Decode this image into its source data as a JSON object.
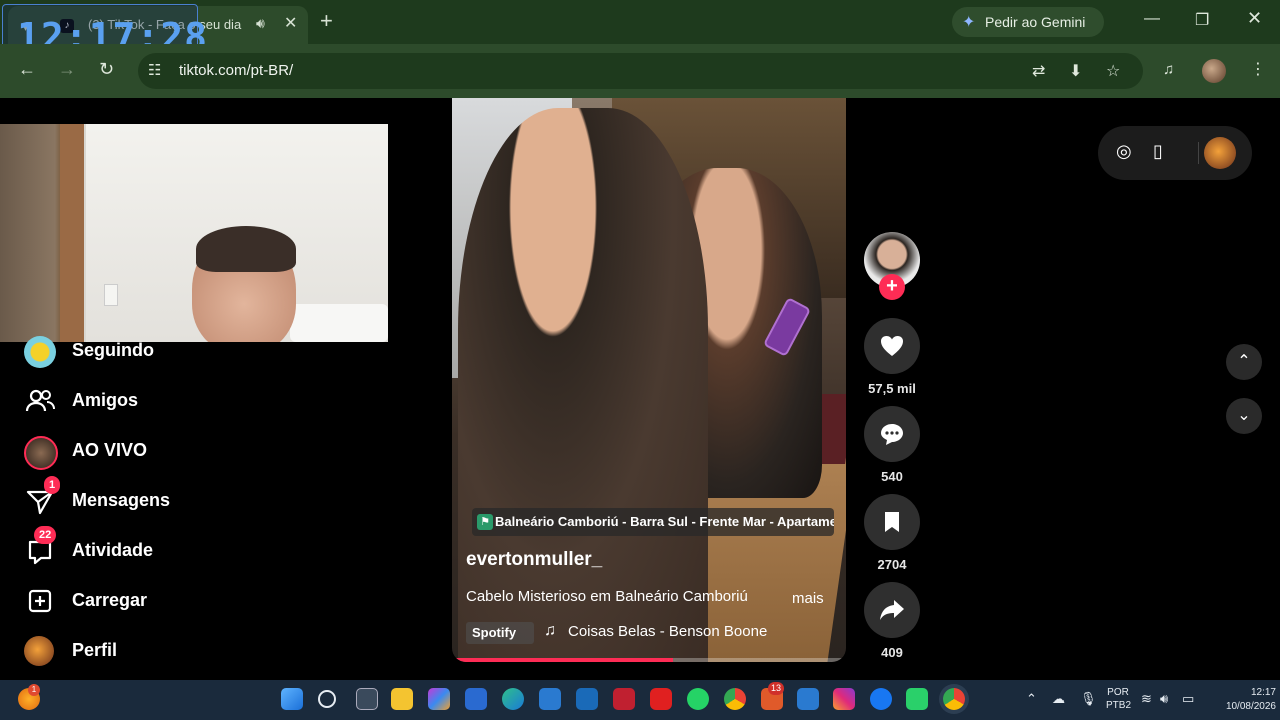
{
  "browser": {
    "tab_title": "(3) TikTok - Faça o seu dia",
    "tab_favicon_glyph": "♪",
    "clock_overlay": "12:17:28",
    "new_tab_glyph": "+",
    "gemini_label": "Pedir ao Gemini",
    "url": "tiktok.com/pt-BR/"
  },
  "sidebar": {
    "items": [
      {
        "label": "Seguindo",
        "icon": "spongebob-avatar"
      },
      {
        "label": "Amigos",
        "icon": "friends-icon"
      },
      {
        "label": "AO VIVO",
        "icon": "live-avatar"
      },
      {
        "label": "Mensagens",
        "icon": "messages-icon",
        "badge": "1"
      },
      {
        "label": "Atividade",
        "icon": "activity-icon",
        "badge": "22"
      },
      {
        "label": "Carregar",
        "icon": "upload-icon"
      },
      {
        "label": "Perfil",
        "icon": "profile-avatar"
      }
    ]
  },
  "video": {
    "location": "Balneário Camboriú - Barra Sul - Frente Mar - Apartamento",
    "author": "evertonmuller_",
    "description": "Cabelo Misterioso em Balneário Camboriú",
    "more_label": "mais",
    "spotify_label": "Spotify",
    "music": "Coisas Belas - Benson Boone",
    "progress": 0.56
  },
  "actions": {
    "likes": "57,5 mil",
    "comments": "540",
    "saves": "2704",
    "shares": "409"
  },
  "taskbar": {
    "weather_badge": "1",
    "instagram_badge": "13",
    "lang_line1": "POR",
    "lang_line2": "PTB2",
    "time": "12:17",
    "date": "10/08/2026"
  },
  "colors": {
    "tiktok_accent": "#fe2c55",
    "chrome_frame": "#1e3a1d",
    "chrome_toolbar": "#2d4b2b",
    "taskbar": "#1a2a3c"
  }
}
